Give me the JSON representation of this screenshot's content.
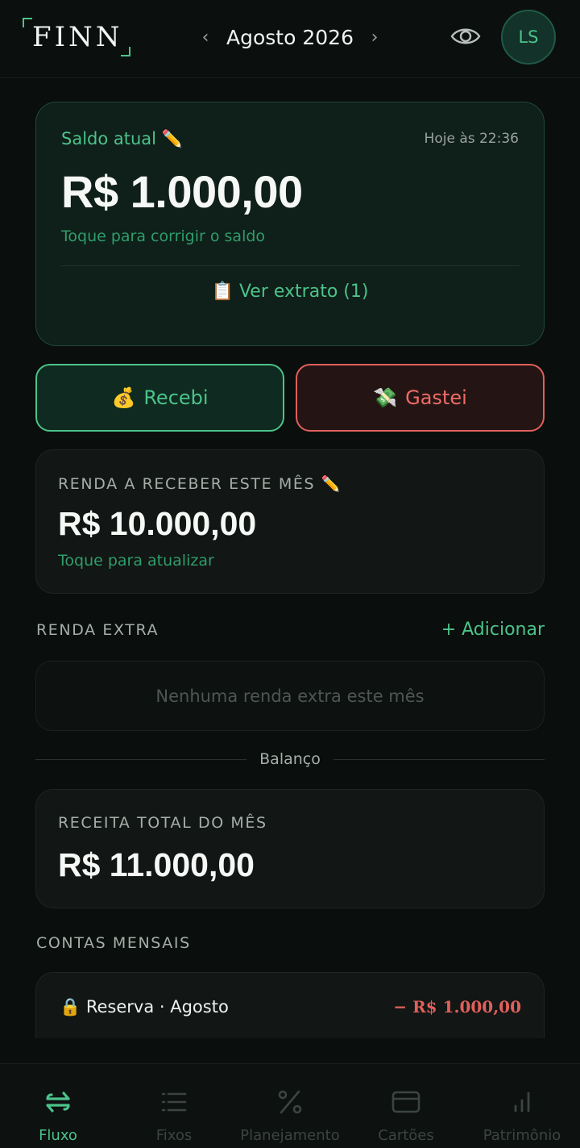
{
  "header": {
    "logo": "FINN",
    "prev_arrow": "‹",
    "month": "Agosto 2026",
    "next_arrow": "›",
    "avatar_initials": "LS"
  },
  "balance": {
    "label": "Saldo atual ✏️",
    "timestamp": "Hoje às 22:36",
    "value": "R$ 1.000,00",
    "hint": "Toque para corrigir o saldo",
    "statement_icon": "📋",
    "statement_label": "Ver extrato (1)"
  },
  "actions": {
    "received_icon": "💰",
    "received_label": "Recebi",
    "spent_icon": "💸",
    "spent_label": "Gastei"
  },
  "income": {
    "label": "RENDA A RECEBER ESTE MÊS ✏️",
    "value": "R$ 10.000,00",
    "hint": "Toque para atualizar"
  },
  "extra_income": {
    "title": "RENDA EXTRA",
    "add_label": "+ Adicionar",
    "empty_text": "Nenhuma renda extra este mês"
  },
  "divider_label": "Balanço",
  "total_revenue": {
    "label": "RECEITA TOTAL DO MÊS",
    "value": "R$ 11.000,00"
  },
  "monthly_bills": {
    "title": "CONTAS MENSAIS",
    "items": [
      {
        "icon": "🔒",
        "name": "Reserva · Agosto",
        "amount": "− R$ 1.000,00"
      }
    ]
  },
  "nav": {
    "items": [
      {
        "label": "Fluxo",
        "icon": "arrows-swap-icon",
        "active": true
      },
      {
        "label": "Fixos",
        "icon": "list-icon",
        "active": false
      },
      {
        "label": "Planejamento",
        "icon": "percent-icon",
        "active": false
      },
      {
        "label": "Cartões",
        "icon": "credit-card-icon",
        "active": false
      },
      {
        "label": "Patrimônio",
        "icon": "bar-chart-icon",
        "active": false
      }
    ]
  },
  "colors": {
    "accent_green": "#4cc38a",
    "accent_red": "#e0605c",
    "background": "#0a0e0c"
  }
}
